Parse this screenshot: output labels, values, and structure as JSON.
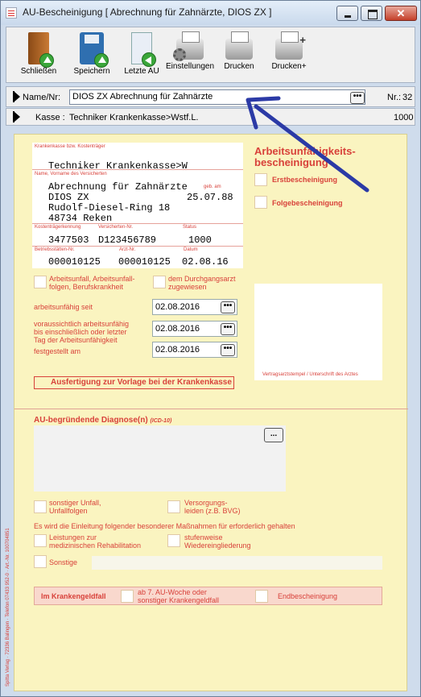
{
  "window": {
    "title": "AU-Bescheinigung  [ Abrechnung für Zahnärzte, DIOS ZX ]",
    "close_glyph": "✕"
  },
  "toolbar": {
    "schliessen": "Schließen",
    "speichern": "Speichern",
    "letzte_au": "Letzte AU",
    "einstellungen": "Einstellungen",
    "drucken": "Drucken",
    "drucken_plus": "Drucken+"
  },
  "patient": {
    "name_label": "Name/Nr:",
    "name_value": "DIOS ZX Abrechnung für Zahnärzte",
    "lookup_btn": "•••",
    "nr_label": "Nr.:",
    "nr_value": "32",
    "kasse_label": "Kasse :",
    "kasse_value": "Techniker Krankenkasse>Wstf.L.",
    "kasse_nr": "1000"
  },
  "form": {
    "krankenkasse_lbl": "Krankenkasse bzw. Kostenträger",
    "krankenkasse_val": "Techniker Krankenkasse>W",
    "name_lbl": "Name, Vorname des Versicherten",
    "geb_lbl": "geb. am",
    "name_line1": "Abrechnung für Zahnärzte",
    "name_line2": "DIOS ZX",
    "geb_val": "25.07.88",
    "street": "Rudolf-Diesel-Ring 18",
    "city": "48734 Reken",
    "kt_lbl": "Kostenträgerkennung",
    "vers_lbl": "Versicherten-Nr.",
    "status_lbl": "Status",
    "kt_val": "3477503",
    "vers_val": "D123456789",
    "status_val": "1000",
    "bs_lbl": "Betriebsstätten-Nr.",
    "arzt_lbl": "Arzt-Nr.",
    "datum_lbl": "Datum",
    "bs_val": "000010125",
    "arzt_val": "000010125",
    "datum_val": "02.08.16",
    "title1": "Arbeitsunfähigkeits-",
    "title2": "bescheinigung",
    "erst": "Erstbescheinigung",
    "folge": "Folgebescheinigung",
    "unfall1": "Arbeitsunfall, Arbeitsunfall-",
    "unfall2": "folgen, Berufskrankheit",
    "durchgang1": "dem Durchgangsarzt",
    "durchgang2": "zugewiesen",
    "au_seit": "arbeitsunfähig seit",
    "au_seit_val": "02.08.2016",
    "vorauss1": "voraussichtlich arbeitsunfähig",
    "vorauss2": "bis einschließlich oder letzter",
    "vorauss3": "Tag der Arbeitsunfähigkeit",
    "vorauss_val": "02.08.2016",
    "festgestellt": "festgestellt am",
    "festgestellt_val": "02.08.2016",
    "stempel": "Vertragsarztstempel / Unterschrift des Arztes",
    "ausfertigung": "Ausfertigung zur Vorlage bei der Krankenkasse",
    "diagnose": "AU-begründende Diagnose(n)",
    "icd": "(ICD-10)",
    "diag_btn": "...",
    "sonst_unfall1": "sonstiger Unfall,",
    "sonst_unfall2": "Unfallfolgen",
    "versorg1": "Versorgungs-",
    "versorg2": "leiden (z.B. BVG)",
    "massnahmen": "Es wird die Einleitung folgender besonderer Maßnahmen für erforderlich gehalten",
    "reha1": "Leistungen zur",
    "reha2": "medizinischen Rehabilitation",
    "stufen1": "stufenweise",
    "stufen2": "Wiedereingliederung",
    "sonstige": "Sonstige",
    "krankengeld": "Im Krankengeldfall",
    "woche1": "ab 7. AU-Woche oder",
    "woche2": "sonstiger Krankengeldfall",
    "endbesch": "Endbescheinigung",
    "sideprint": "Spitta Verlag · 72336 Balingen · Telefon 07433 952-0 · Art.-Nr. 100704851"
  },
  "colors": {
    "form_bg": "#faf4c0",
    "form_red": "#d8413a",
    "arrow": "#2b3aa6"
  }
}
